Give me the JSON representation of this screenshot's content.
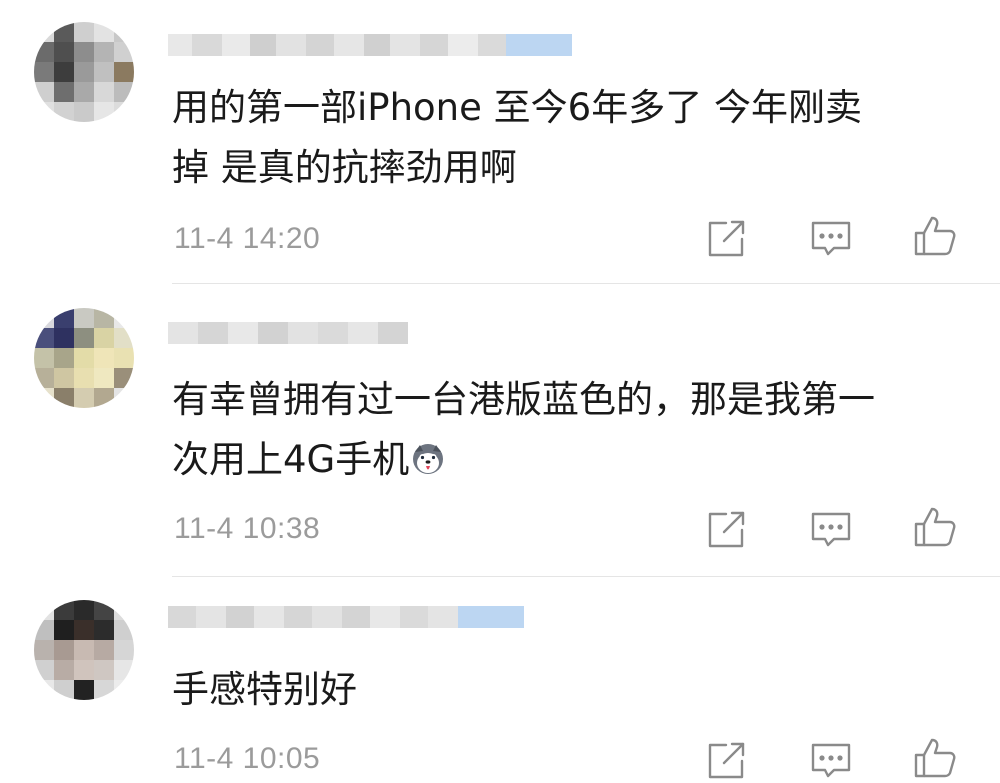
{
  "comments": [
    {
      "text_line1": "用的第一部iPhone  至今6年多了 今年刚卖",
      "text_line2": "掉 是真的抗摔劲用啊",
      "timestamp": "11-4 14:20"
    },
    {
      "text_line1": "有幸曾拥有过一台港版蓝色的，那是我第一",
      "text_line2": "次用上4G手机",
      "timestamp": "11-4 10:38",
      "emoji": "husky-emoji"
    },
    {
      "text_line1": "手感特别好",
      "timestamp": "11-4 10:05"
    }
  ],
  "icons": {
    "share": "share-icon",
    "reply": "comment-icon",
    "like": "thumbs-up-icon"
  },
  "colors": {
    "timestamp": "#9b9b9b",
    "icon": "#8a8a8a",
    "divider": "#e5e5e5",
    "text": "#1a1a1a"
  }
}
